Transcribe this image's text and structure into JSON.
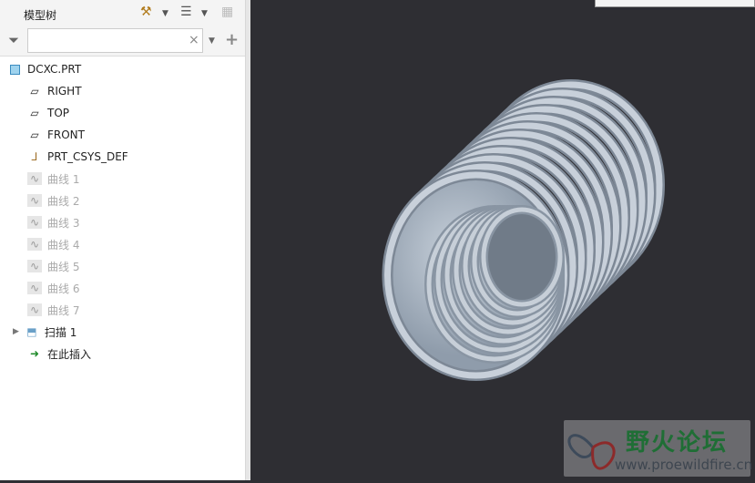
{
  "panel": {
    "title": "模型树",
    "filter_placeholder": "",
    "clear": "×",
    "add": "+"
  },
  "tree": [
    {
      "label": "DCXC.PRT",
      "icon": "part-icon",
      "dim": false
    },
    {
      "label": "RIGHT",
      "icon": "datum-plane-icon",
      "dim": false
    },
    {
      "label": "TOP",
      "icon": "datum-plane-icon",
      "dim": false
    },
    {
      "label": "FRONT",
      "icon": "datum-plane-icon",
      "dim": false
    },
    {
      "label": "PRT_CSYS_DEF",
      "icon": "csys-icon",
      "dim": false
    },
    {
      "label": "曲线 1",
      "icon": "curve-icon",
      "dim": true
    },
    {
      "label": "曲线 2",
      "icon": "curve-icon",
      "dim": true
    },
    {
      "label": "曲线 3",
      "icon": "curve-icon",
      "dim": true
    },
    {
      "label": "曲线 4",
      "icon": "curve-icon",
      "dim": true
    },
    {
      "label": "曲线 5",
      "icon": "curve-icon",
      "dim": true
    },
    {
      "label": "曲线 6",
      "icon": "curve-icon",
      "dim": true
    },
    {
      "label": "曲线 7",
      "icon": "curve-icon",
      "dim": true
    },
    {
      "label": "扫描 1",
      "icon": "sweep-icon",
      "dim": false
    },
    {
      "label": "在此插入",
      "icon": "insert-here-icon",
      "dim": false
    }
  ],
  "watermark": {
    "name": "野火论坛",
    "url": "www.proewildfire.cn"
  }
}
